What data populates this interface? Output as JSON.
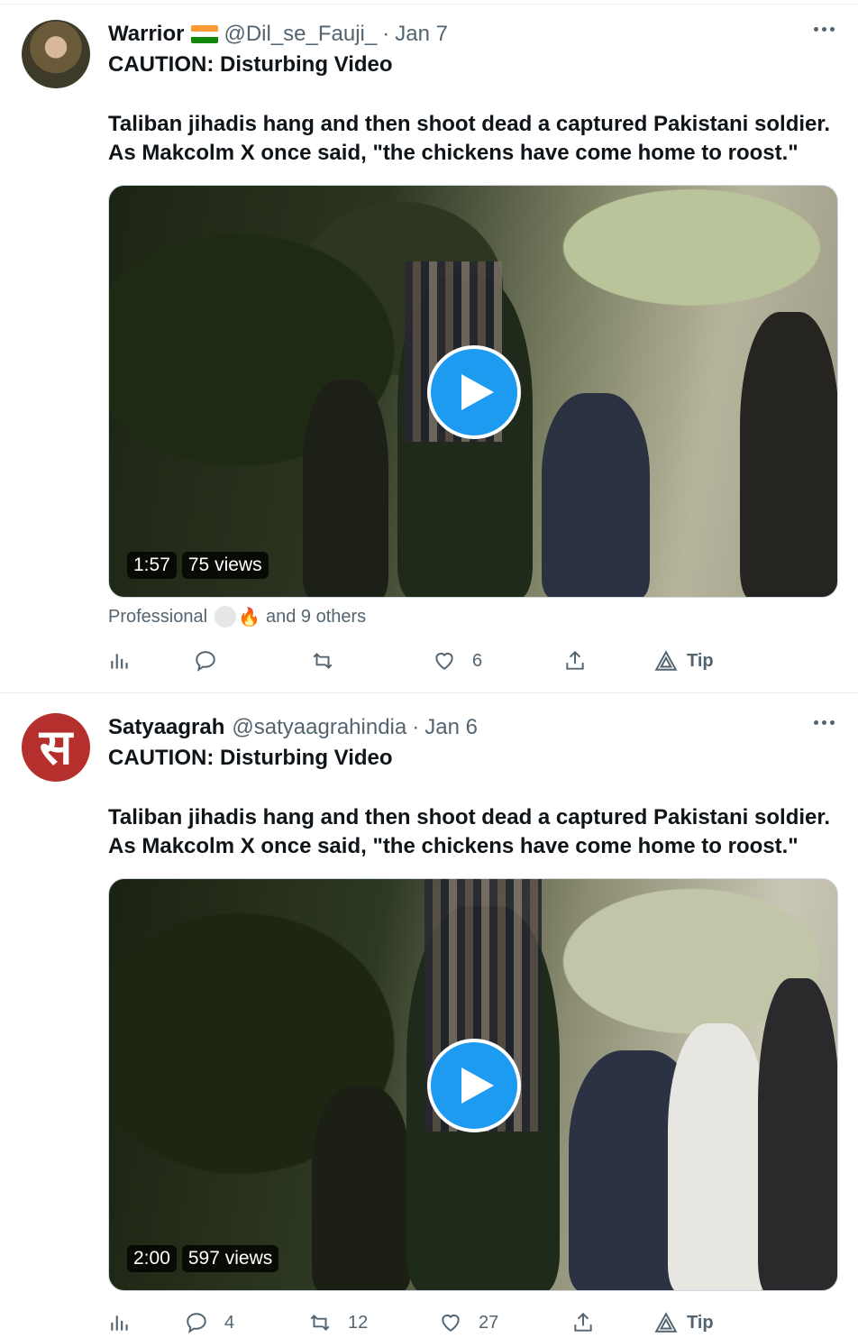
{
  "tweets": [
    {
      "display_name": "Warrior",
      "handle": "@Dil_se_Fauji_",
      "separator": "·",
      "date": "Jan 7",
      "caution": "CAUTION: Disturbing Video",
      "body_lines": [
        "Taliban jihadis hang and then shoot dead a captured Pakistani soldier.",
        "As Makcolm X once said, \"the chickens have come home to roost.\""
      ],
      "media": {
        "duration": "1:57",
        "views": "75 views"
      },
      "liked_by": {
        "prefix": "Professional",
        "suffix": "and 9 others"
      },
      "actions": {
        "analytics": "",
        "replies": "",
        "retweets": "",
        "likes": "6",
        "share": "",
        "tip": "Tip"
      }
    },
    {
      "display_name": "Satyaagrah",
      "handle": "@satyaagrahindia",
      "separator": "·",
      "date": "Jan 6",
      "avatar_glyph": "स",
      "caution": "CAUTION: Disturbing Video",
      "body_lines": [
        "Taliban jihadis hang and then shoot dead a captured Pakistani soldier.",
        "As Makcolm X once said, \"the chickens have come home to roost.\""
      ],
      "media": {
        "duration": "2:00",
        "views": "597 views"
      },
      "actions": {
        "analytics": "",
        "replies": "4",
        "retweets": "12",
        "likes": "27",
        "share": "",
        "tip": "Tip"
      }
    }
  ],
  "icons": {
    "play": "play-icon",
    "more": "more-icon",
    "analytics": "analytics-icon",
    "reply": "reply-icon",
    "retweet": "retweet-icon",
    "like": "heart-icon",
    "share": "share-icon",
    "tip": "tip-icon"
  },
  "colors": {
    "accent": "#1d9bf0",
    "secondary_text": "#536471",
    "avatar_red": "#b5302c"
  }
}
